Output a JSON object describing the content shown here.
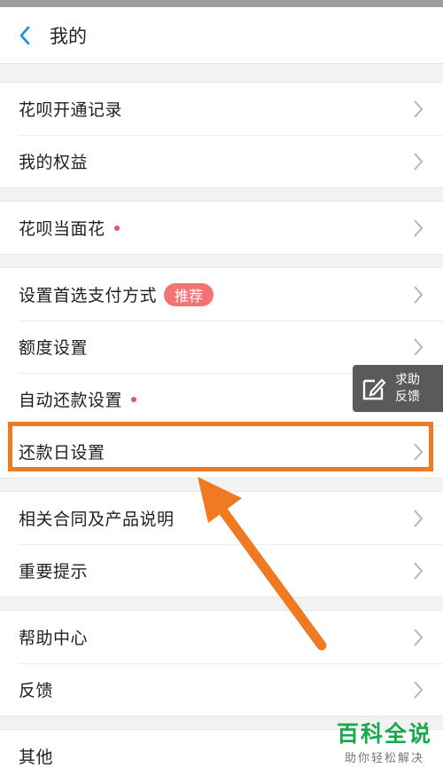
{
  "header": {
    "title": "我的"
  },
  "groups": [
    {
      "items": [
        {
          "label": "花呗开通记录"
        },
        {
          "label": "我的权益"
        }
      ]
    },
    {
      "items": [
        {
          "label": "花呗当面花",
          "dot": true
        }
      ]
    },
    {
      "items": [
        {
          "label": "设置首选支付方式",
          "badge": "推荐"
        },
        {
          "label": "额度设置"
        },
        {
          "label": "自动还款设置",
          "dot": true
        },
        {
          "label": "还款日设置",
          "highlighted": true
        }
      ]
    },
    {
      "items": [
        {
          "label": "相关合同及产品说明"
        },
        {
          "label": "重要提示"
        }
      ]
    },
    {
      "items": [
        {
          "label": "帮助中心"
        },
        {
          "label": "反馈"
        }
      ]
    },
    {
      "items": [
        {
          "label": "其他"
        }
      ]
    }
  ],
  "help_float": {
    "line1": "求助",
    "line2": "反馈"
  },
  "watermark": {
    "title": "百科全说",
    "subtitle": "助你轻松解决"
  },
  "colors": {
    "highlight": "#f07a22",
    "badge": "#f47474",
    "dot": "#e8555a",
    "accent": "#1a8fe0"
  }
}
